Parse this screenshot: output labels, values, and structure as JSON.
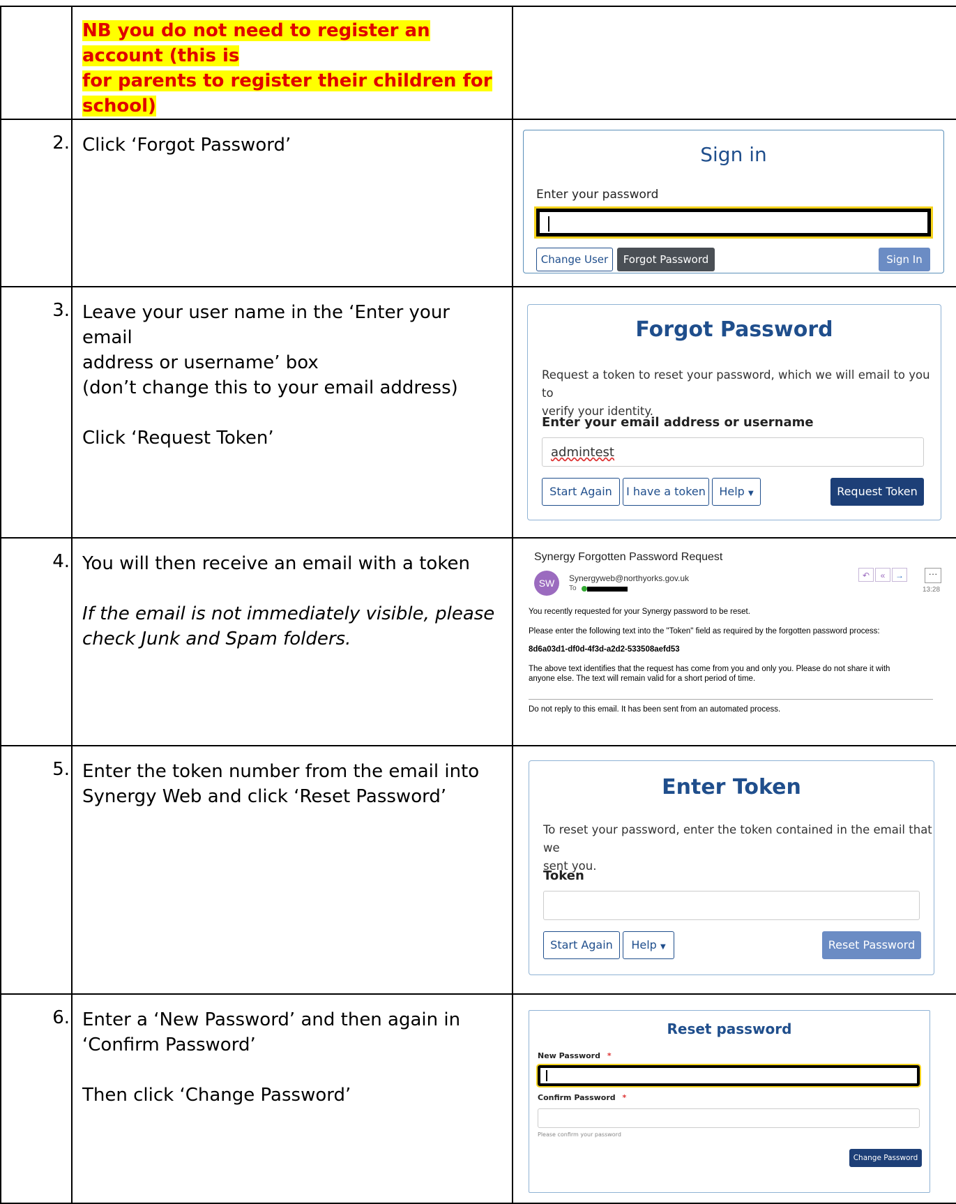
{
  "note": {
    "line1": "NB you do not need to register an account (this is",
    "line2": "for parents to register their children for school)"
  },
  "steps": [
    {
      "number": "2.",
      "lines": [
        "Click ‘Forgot Password’"
      ]
    },
    {
      "number": "3.",
      "lines": [
        "Leave your user name in the ‘Enter your email",
        "address or username’ box",
        "(don’t change this to your email address)",
        "",
        "Click ‘Request Token’"
      ]
    },
    {
      "number": "4.",
      "lines": [
        "You will then receive an email with a token",
        ""
      ],
      "italic_lines": [
        "If the email is not immediately visible, please",
        "check Junk and Spam folders."
      ]
    },
    {
      "number": "5.",
      "lines": [
        "Enter the token number from the email into",
        "Synergy Web and click ‘Reset Password’"
      ]
    },
    {
      "number": "6.",
      "lines": [
        "Enter a ‘New Password’ and then again in",
        "‘Confirm Password’",
        "",
        "Then click ‘Change Password’"
      ]
    }
  ],
  "signin": {
    "title": "Sign in",
    "label": "Enter your password",
    "change_user": "Change User",
    "forgot_password": "Forgot Password",
    "sign_in": "Sign In"
  },
  "forgot": {
    "title": "Forgot Password",
    "desc_line1": "Request a token to reset your password, which we will email to you to",
    "desc_line2": "verify your identity.",
    "label": "Enter your email address or username",
    "value": "admintest",
    "start_again": "Start Again",
    "have_token": "I have a token",
    "help": "Help",
    "request_token": "Request Token"
  },
  "email": {
    "subject": "Synergy Forgotten Password Request",
    "avatar": "SW",
    "from": "Synergyweb@northyorks.gov.uk",
    "to": "To",
    "time": "13:28",
    "line1": "You recently requested for your Synergy password to be reset.",
    "line2": "Please enter the following text into the \"Token\" field as required by the forgotten password process:",
    "token": "8d6a03d1-df0d-4f3d-a2d2-533508aefd53",
    "line3": "The above text identifies that the request has come from you and only you. Please do not share it with",
    "line4": "anyone else. The text will remain valid for a short period of time.",
    "footer": "Do not reply to this email. It has been sent from an automated process.",
    "more": "···"
  },
  "token": {
    "title": "Enter Token",
    "desc_line1": "To reset your password, enter the token contained in the email that we",
    "desc_line2": "sent you.",
    "label": "Token",
    "start_again": "Start Again",
    "help": "Help",
    "reset": "Reset Password"
  },
  "reset": {
    "title": "Reset password",
    "new_label": "New Password",
    "confirm_label": "Confirm Password",
    "required": "*",
    "hint": "Please confirm your password",
    "change": "Change Password"
  }
}
